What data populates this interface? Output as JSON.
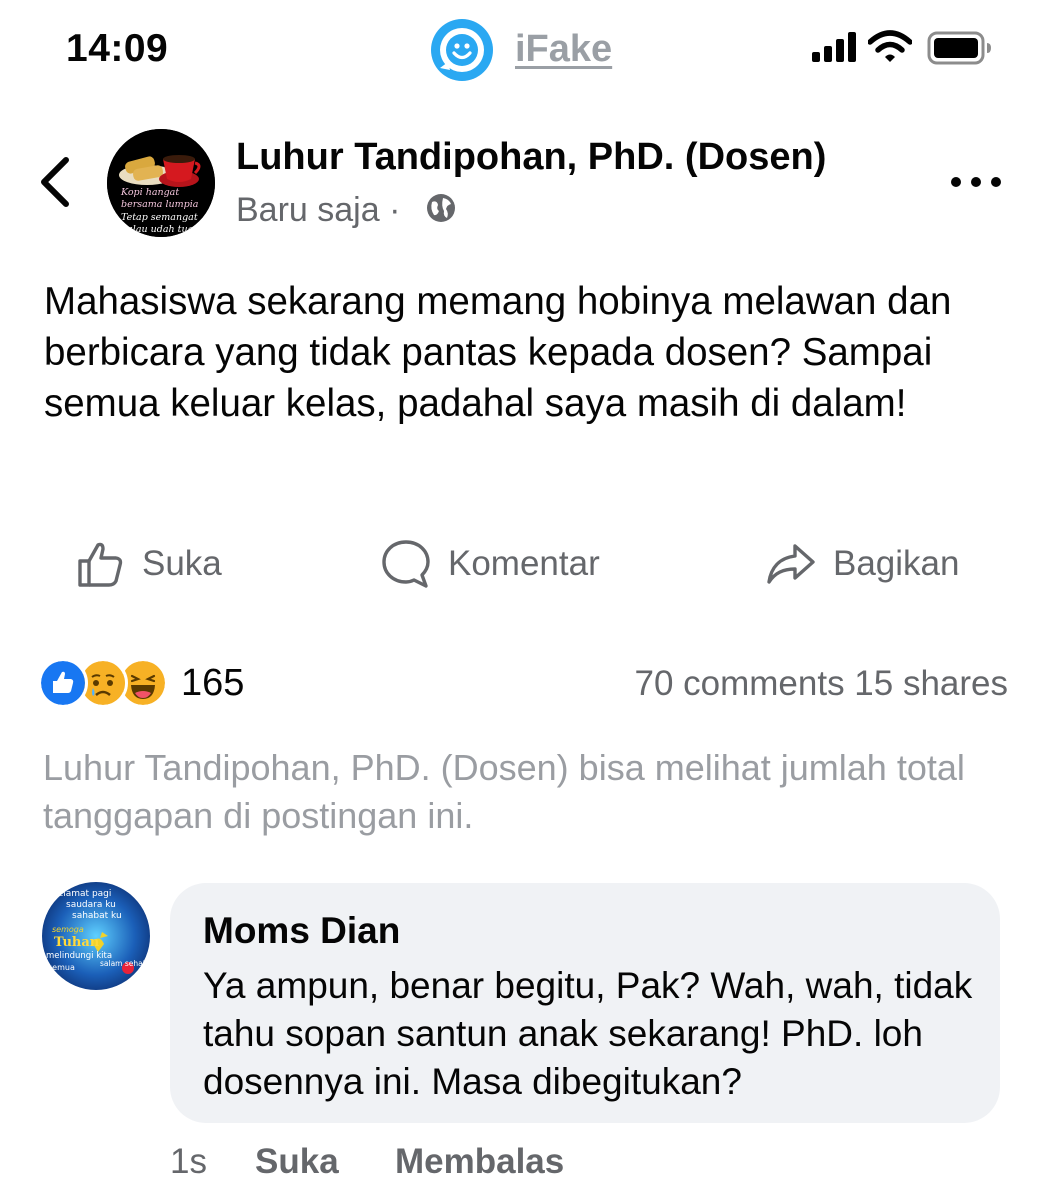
{
  "status_bar": {
    "time": "14:09",
    "app_label": "iFake",
    "icons": [
      "signal-icon",
      "wifi-icon",
      "battery-icon"
    ]
  },
  "post": {
    "author_name": "Luhur Tandipohan, PhD. (Dosen)",
    "timestamp": "Baru saja ·",
    "privacy_icon": "globe-icon",
    "avatar_caption": [
      "Kopi hangat",
      "bersama lumpia",
      "Tetap semangat",
      "walau udah tua"
    ],
    "body": "Mahasiswa sekarang memang hobinya melawan dan berbicara yang tidak pantas kepada dosen? Sampai semua keluar kelas, padahal saya masih di dalam!",
    "actions": {
      "like_label": "Suka",
      "comment_label": "Komentar",
      "share_label": "Bagikan"
    },
    "reactions": {
      "types": [
        "like",
        "sad",
        "haha"
      ],
      "count": "165"
    },
    "comments_shares": "70 comments 15 shares",
    "visibility_note": "Luhur Tandipohan, PhD. (Dosen) bisa melihat jumlah total tanggapan di postingan ini."
  },
  "comment": {
    "author_name": "Moms Dian",
    "avatar_caption": [
      "Selamat pagi",
      "saudara ku",
      "sahabat ku",
      "semoga",
      "Tuhan",
      "melindungi kita",
      "semua",
      "salam sehat"
    ],
    "text": "Ya ampun, benar begitu, Pak? Wah, wah, tidak tahu sopan santun anak sekarang! PhD. loh dosennya ini. Masa dibegitukan?",
    "time": "1s",
    "like_label": "Suka",
    "reply_label": "Membalas"
  },
  "colors": {
    "secondary_text": "#65676b",
    "bubble_bg": "#f0f2f5",
    "brand_blue": "#1877f2",
    "ifake_blue": "#2aa8f2"
  }
}
